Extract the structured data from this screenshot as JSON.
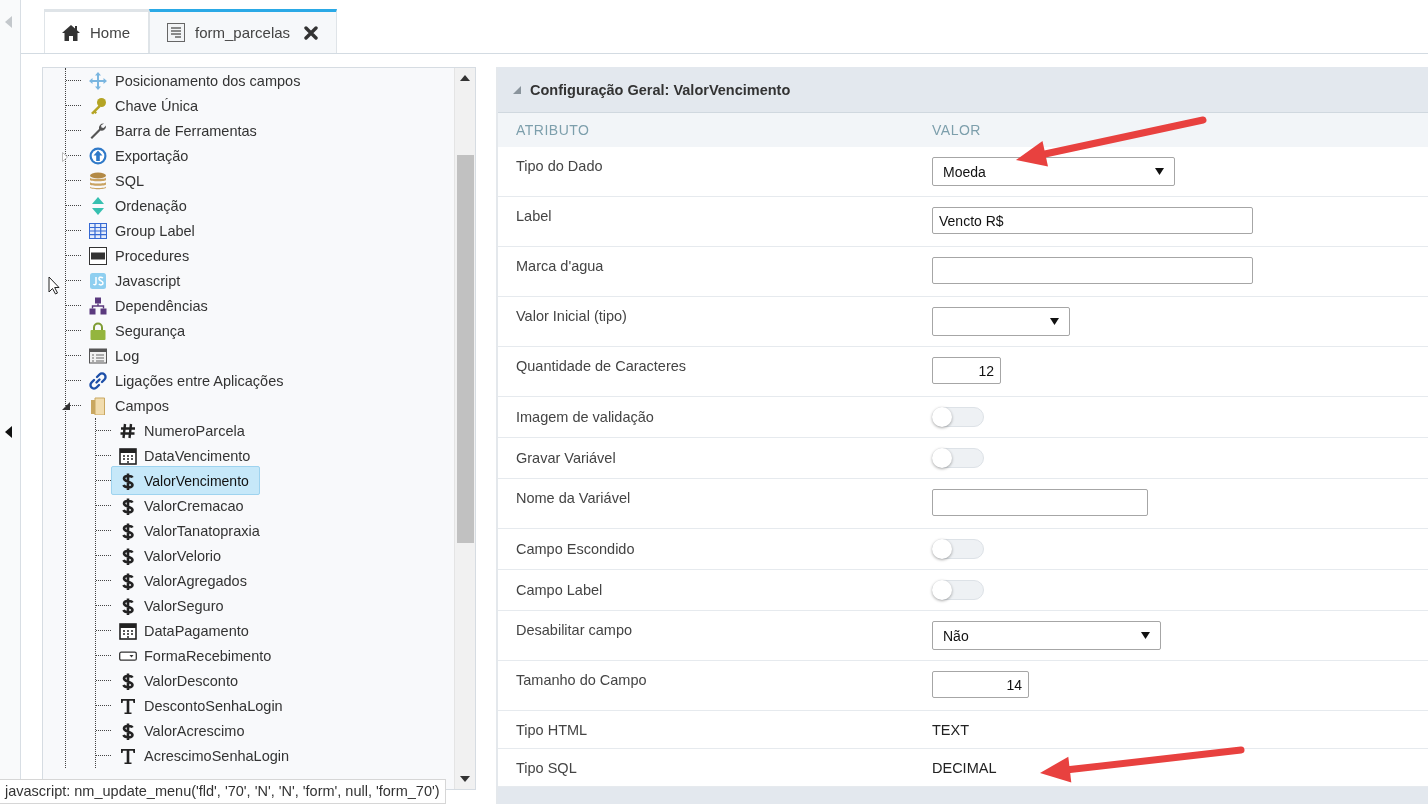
{
  "tabs": [
    {
      "label": "Home",
      "kind": "home",
      "selected": false,
      "closable": false
    },
    {
      "label": "form_parcelas",
      "kind": "form",
      "selected": true,
      "closable": true
    }
  ],
  "tree": {
    "items": [
      {
        "label": "Posicionamento dos campos",
        "kind": "layout",
        "selected": false
      },
      {
        "label": "Chave Única",
        "kind": "unique-key",
        "selected": false
      },
      {
        "label": "Barra de Ferramentas",
        "kind": "toolbar",
        "selected": false
      },
      {
        "label": "Exportação",
        "kind": "export",
        "selected": false,
        "expanded": false
      },
      {
        "label": "SQL",
        "kind": "sql",
        "selected": false
      },
      {
        "label": "Ordenação",
        "kind": "sorting",
        "selected": false
      },
      {
        "label": "Group Label",
        "kind": "group-label",
        "selected": false
      },
      {
        "label": "Procedures",
        "kind": "procedures",
        "selected": false
      },
      {
        "label": "Javascript",
        "kind": "javascript",
        "selected": false
      },
      {
        "label": "Dependências",
        "kind": "dependencies",
        "selected": false
      },
      {
        "label": "Segurança",
        "kind": "security",
        "selected": false
      },
      {
        "label": "Log",
        "kind": "log",
        "selected": false
      },
      {
        "label": "Ligações entre Aplicações",
        "kind": "links",
        "selected": false
      },
      {
        "label": "Campos",
        "kind": "fields",
        "selected": false,
        "expanded": true,
        "children": [
          {
            "label": "NumeroParcela",
            "kind": "number",
            "selected": false
          },
          {
            "label": "DataVencimento",
            "kind": "date",
            "selected": false
          },
          {
            "label": "ValorVencimento",
            "kind": "currency",
            "selected": true
          },
          {
            "label": "ValorCremacao",
            "kind": "currency",
            "selected": false
          },
          {
            "label": "ValorTanatopraxia",
            "kind": "currency",
            "selected": false
          },
          {
            "label": "ValorVelorio",
            "kind": "currency",
            "selected": false
          },
          {
            "label": "ValorAgregados",
            "kind": "currency",
            "selected": false
          },
          {
            "label": "ValorSeguro",
            "kind": "currency",
            "selected": false
          },
          {
            "label": "DataPagamento",
            "kind": "date",
            "selected": false
          },
          {
            "label": "FormaRecebimento",
            "kind": "select",
            "selected": false
          },
          {
            "label": "ValorDesconto",
            "kind": "currency",
            "selected": false
          },
          {
            "label": "DescontoSenhaLogin",
            "kind": "text",
            "selected": false
          },
          {
            "label": "ValorAcrescimo",
            "kind": "currency",
            "selected": false
          },
          {
            "label": "AcrescimoSenhaLogin",
            "kind": "text",
            "selected": false
          }
        ]
      }
    ]
  },
  "config": {
    "title": "Configuração Geral: ValorVencimento",
    "expanded": true,
    "columns": [
      "ATRIBUTO",
      "VALOR"
    ],
    "rows": [
      {
        "label": "Tipo do Dado",
        "kind": "select",
        "value": "Moeda",
        "arrow_marked": true
      },
      {
        "label": "Label",
        "kind": "input",
        "value": "Vencto R$",
        "arrow_marked": false
      },
      {
        "label": "Marca d'agua",
        "kind": "input",
        "arrow_marked": false
      },
      {
        "label": "Valor Inicial (tipo)",
        "kind": "select",
        "arrow_marked": false
      },
      {
        "label": "Quantidade de Caracteres",
        "kind": "number",
        "value": "12",
        "arrow_marked": false
      },
      {
        "label": "Imagem de validação",
        "kind": "toggle",
        "on": false,
        "arrow_marked": false
      },
      {
        "label": "Gravar Variável",
        "kind": "toggle",
        "on": false,
        "arrow_marked": false
      },
      {
        "label": "Nome da Variável",
        "kind": "input",
        "arrow_marked": false
      },
      {
        "label": "Campo Escondido",
        "kind": "toggle",
        "on": false,
        "arrow_marked": false
      },
      {
        "label": "Campo Label",
        "kind": "toggle",
        "on": false,
        "arrow_marked": false
      },
      {
        "label": "Desabilitar campo",
        "kind": "select",
        "value": "Não",
        "arrow_marked": false
      },
      {
        "label": "Tamanho do Campo",
        "kind": "number",
        "value": "14",
        "arrow_marked": false
      },
      {
        "label": "Tipo HTML",
        "kind": "static",
        "value": "TEXT",
        "arrow_marked": false
      },
      {
        "label": "Tipo SQL",
        "kind": "static",
        "value": "DECIMAL",
        "arrow_marked": true
      }
    ]
  },
  "status_bar": {
    "text": "javascript: nm_update_menu('fld', '70', 'N', 'N', 'form', null, 'form_70')"
  }
}
